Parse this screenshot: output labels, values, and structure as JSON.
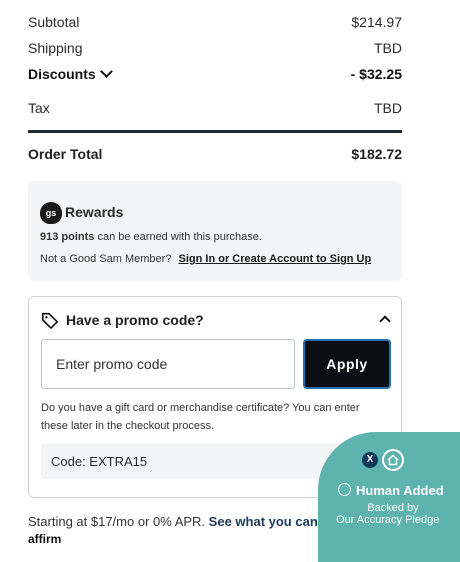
{
  "summary": {
    "subtotal_label": "Subtotal",
    "subtotal_value": "$214.97",
    "shipping_label": "Shipping",
    "shipping_value": "TBD",
    "discounts_label": "Discounts",
    "discounts_value": "- $32.25",
    "tax_label": "Tax",
    "tax_value": "TBD",
    "order_total_label": "Order Total",
    "order_total_value": "$182.72"
  },
  "rewards": {
    "badge_text": "gs",
    "title": "Rewards",
    "points_strong": "913 points",
    "points_rest": "can be earned with this purchase.",
    "member_text": "Not a Good Sam Member?",
    "member_link": "Sign In or Create Account to Sign Up"
  },
  "promo": {
    "title": "Have a promo code?",
    "input_placeholder": "Enter promo code",
    "apply_label": "Apply",
    "note": "Do you have a gift card or merchandise certificate? You can enter these later in the checkout process.",
    "code_text": "Code: EXTRA15"
  },
  "financing": {
    "text": "Starting at $17/mo or 0% APR.",
    "link": "See what you can spend",
    "logo_text": "affirm"
  },
  "trust_badge": {
    "close_label": "X",
    "added_text": "Human Added",
    "backed_text": "Backed by",
    "pledge_text": "Our Accuracy Pledge"
  },
  "icons": {
    "chevron": "chevron-down-icon",
    "tag": "tag-icon",
    "caret": "chevron-up-icon",
    "home": "home-icon",
    "check": "check-circle-icon"
  }
}
